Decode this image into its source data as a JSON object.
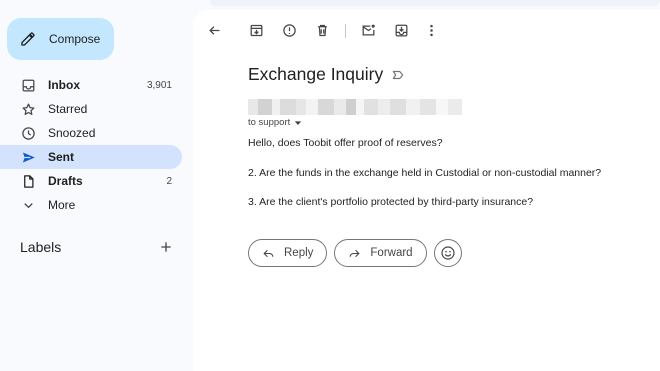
{
  "sidebar": {
    "compose_label": "Compose",
    "items": [
      {
        "label": "Inbox",
        "count": "3,901",
        "icon": "inbox-icon",
        "bold": true
      },
      {
        "label": "Starred",
        "count": "",
        "icon": "star-icon",
        "bold": false
      },
      {
        "label": "Snoozed",
        "count": "",
        "icon": "clock-icon",
        "bold": false
      },
      {
        "label": "Sent",
        "count": "",
        "icon": "send-icon",
        "bold": true,
        "active": true
      },
      {
        "label": "Drafts",
        "count": "2",
        "icon": "draft-icon",
        "bold": true
      },
      {
        "label": "More",
        "count": "",
        "icon": "chevron-down-icon",
        "bold": false
      }
    ],
    "labels_title": "Labels"
  },
  "email": {
    "subject": "Exchange Inquiry",
    "to_line": "to support",
    "body": [
      "Hello, does Toobit offer proof of reserves?",
      "2. Are the funds in the exchange held in Custodial or non-custodial manner?",
      "3. Are the client's portfolio protected by third-party insurance?"
    ]
  },
  "actions": {
    "reply_label": "Reply",
    "forward_label": "Forward"
  },
  "colors": {
    "compose_bg": "#c2e7ff",
    "active_nav_bg": "#d3e3fd",
    "page_bg": "#f8fafd"
  }
}
